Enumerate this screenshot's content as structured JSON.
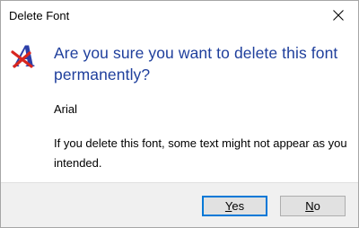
{
  "window": {
    "title": "Delete Font",
    "close_icon": "close-icon"
  },
  "dialog": {
    "icon": "font-icon",
    "icon_letter": "A",
    "main_instruction": "Are you sure you want to delete this font permanently?",
    "font_name": "Arial",
    "message": "If you delete this font, some text might not appear as you intended."
  },
  "buttons": {
    "yes_mnemonic": "Y",
    "yes_rest": "es",
    "no_mnemonic": "N",
    "no_rest": "o"
  },
  "colors": {
    "instruction_text": "#1f3f9c",
    "footer_background": "#f0f0f0",
    "default_button_border": "#0078d7",
    "icon_letter": "#2c3fa8",
    "icon_cross": "#d8261f"
  }
}
